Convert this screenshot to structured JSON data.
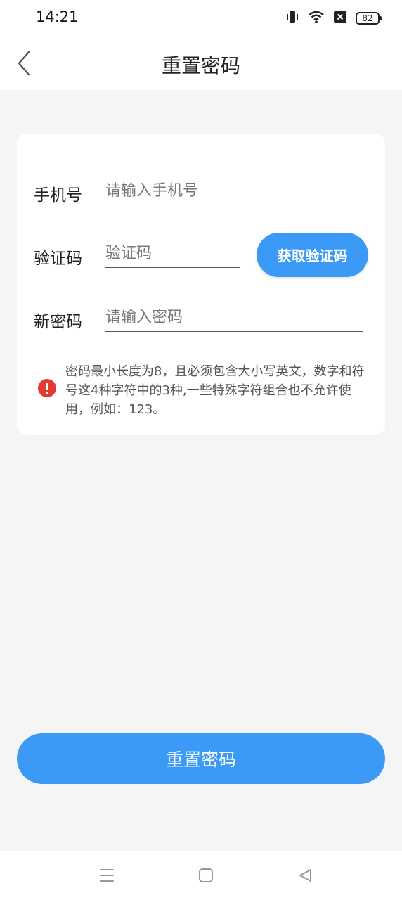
{
  "status_bar": {
    "time": "14:21",
    "battery": "82",
    "icons": [
      "vibrate-icon",
      "wifi-icon",
      "no-sim-icon",
      "battery-icon"
    ]
  },
  "header": {
    "title": "重置密码",
    "back_icon": "chevron-left-icon"
  },
  "form": {
    "phone": {
      "label": "手机号",
      "placeholder": "请输入手机号",
      "value": ""
    },
    "code": {
      "label": "验证码",
      "placeholder": "验证码",
      "value": "",
      "button_label": "获取验证码"
    },
    "password": {
      "label": "新密码",
      "placeholder": "请输入密码",
      "value": ""
    },
    "hint": {
      "icon": "exclamation-icon",
      "text": "密码最小长度为8，且必须包含大小写英文，数字和符号这4种字符中的3种,一些特殊字符组合也不允许使用，例如：123。"
    }
  },
  "submit": {
    "label": "重置密码"
  },
  "colors": {
    "accent": "#3a9af5",
    "warning": "#e53935"
  },
  "system_nav": {
    "icons": [
      "menu-icon",
      "home-icon",
      "back-icon"
    ]
  }
}
